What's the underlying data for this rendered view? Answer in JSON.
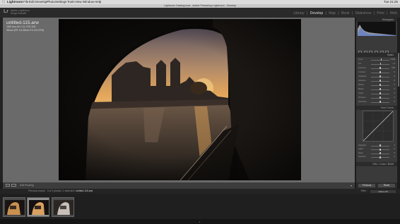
{
  "menu": {
    "app": "Lightroom",
    "items": [
      "File",
      "Edit",
      "Develop",
      "Photo",
      "Settings",
      "Tools",
      "View",
      "Window",
      "Help"
    ],
    "status_right": "Tue 21:26"
  },
  "window": {
    "title": "Lightroom Catalog.lrcat - Adobe Photoshop Lightroom - Develop"
  },
  "identity": {
    "logo": "Lr",
    "line1": "Adobe Lightroom",
    "line2": "Serge Ramelli"
  },
  "modules": [
    "Library",
    "Develop",
    "Map",
    "Book",
    "Slideshow",
    "Print",
    "Web"
  ],
  "active_module": "Develop",
  "image_info": {
    "filename": "untitled-115.arw",
    "line1": "1/60 sec at f / 11, ISO 100",
    "line2": "35mm (FE 16-35mm F4 ZA OSS)"
  },
  "panels": {
    "histogram": "Histogram",
    "basic": "Basic",
    "tone_curve": "Tone Curve",
    "hsl": "HSL / Color / B&W"
  },
  "sliders": [
    {
      "label": "Temp",
      "value": "5,500",
      "pos": 0.55
    },
    {
      "label": "Tint",
      "value": "+ 2",
      "pos": 0.52
    },
    {
      "label": "Exposure",
      "value": "0.00",
      "pos": 0.5
    },
    {
      "label": "Contrast",
      "value": "0",
      "pos": 0.5
    },
    {
      "label": "Highlights",
      "value": "0",
      "pos": 0.5
    },
    {
      "label": "Shadows",
      "value": "0",
      "pos": 0.5
    },
    {
      "label": "Whites",
      "value": "0",
      "pos": 0.5
    },
    {
      "label": "Blacks",
      "value": "0",
      "pos": 0.5
    },
    {
      "label": "Clarity",
      "value": "0",
      "pos": 0.5
    },
    {
      "label": "Vibrance",
      "value": "0",
      "pos": 0.5
    },
    {
      "label": "Saturation",
      "value": "0",
      "pos": 0.5
    }
  ],
  "curve_sliders": [
    {
      "label": "Highlights",
      "value": "0",
      "pos": 0.5
    },
    {
      "label": "Lights",
      "value": "0",
      "pos": 0.5
    },
    {
      "label": "Darks",
      "value": "0",
      "pos": 0.5
    },
    {
      "label": "Shadows",
      "value": "0",
      "pos": 0.5
    }
  ],
  "toolbar": {
    "soft_proofing": "Soft Proofing"
  },
  "buttons": {
    "previous": "Previous",
    "reset": "Reset"
  },
  "filmstrip_bar": {
    "source": "Previous Import",
    "count": "3 of 3 photos / 1 selected /",
    "selected_file": "untitled-115.arw",
    "filter_label": "Filter :",
    "filter_value": "Filters Off"
  },
  "colors": {
    "accent": "#e8e8e8",
    "panel": "#3a3a3a",
    "canvas": "#6a6a6a"
  }
}
